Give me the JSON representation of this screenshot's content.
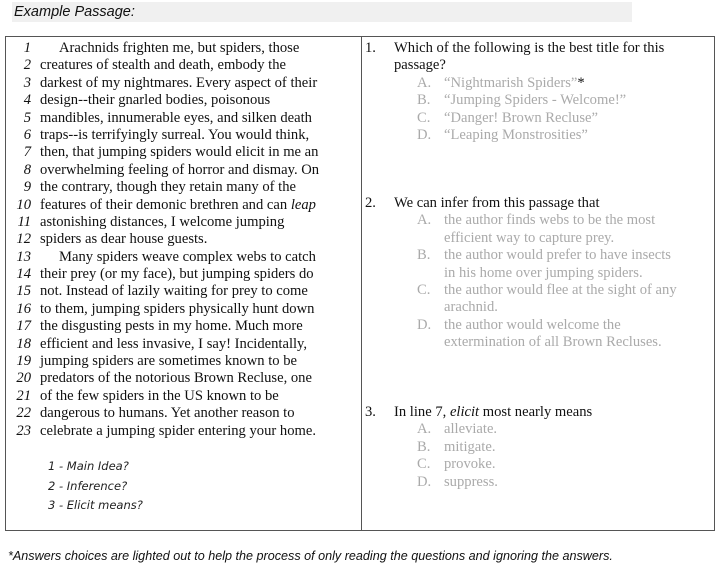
{
  "header": {
    "title": "Example Passage:"
  },
  "passage": {
    "lines": [
      {
        "n": "1",
        "text": "Arachnids frighten me, but spiders, those",
        "indent": true
      },
      {
        "n": "2",
        "text": "creatures of stealth and death, embody the"
      },
      {
        "n": "3",
        "text": "darkest of my nightmares.  Every aspect of their"
      },
      {
        "n": "4",
        "text": "design--their gnarled bodies, poisonous"
      },
      {
        "n": "5",
        "text": "mandibles, innumerable eyes, and silken death"
      },
      {
        "n": "6",
        "text": "traps--is terrifyingly surreal.  You would think,"
      },
      {
        "n": "7",
        "text": "then, that jumping spiders would elicit in me an"
      },
      {
        "n": "8",
        "text": "overwhelming feeling of horror and dismay.  On"
      },
      {
        "n": "9",
        "text": "the contrary, though they retain many of the"
      },
      {
        "n": "10",
        "text": "features of their demonic brethren and can ",
        "em": "leap"
      },
      {
        "n": "11",
        "text": "astonishing distances, I welcome jumping"
      },
      {
        "n": "12",
        "text": "spiders as dear house guests."
      },
      {
        "n": "13",
        "text": "Many spiders weave complex webs to catch",
        "indent": true
      },
      {
        "n": "14",
        "text": "their prey (or my face), but jumping spiders do"
      },
      {
        "n": "15",
        "text": "not.  Instead of lazily waiting for prey to come"
      },
      {
        "n": "16",
        "text": "to them, jumping spiders physically hunt down"
      },
      {
        "n": "17",
        "text": "the disgusting pests in my home.  Much more"
      },
      {
        "n": "18",
        "text": "efficient and less invasive, I say!  Incidentally,"
      },
      {
        "n": "19",
        "text": "jumping spiders are sometimes known to be"
      },
      {
        "n": "20",
        "text": "predators of the notorious Brown Recluse, one"
      },
      {
        "n": "21",
        "text": "of the few spiders in the US known to be"
      },
      {
        "n": "22",
        "text": "dangerous to humans.  Yet another reason to"
      },
      {
        "n": "23",
        "text": "celebrate a jumping spider entering your home."
      }
    ]
  },
  "notes": [
    "1 - Main Idea?",
    "2 - Inference?",
    "3 - Elicit means?"
  ],
  "questions": [
    {
      "n": "1.",
      "text": [
        "Which of the following is the best title for this",
        "passage?"
      ],
      "answers": [
        {
          "l": "A.",
          "t": [
            "“Nightmarish Spiders”"
          ],
          "mark": "*"
        },
        {
          "l": "B.",
          "t": [
            "“Jumping Spiders - Welcome!”"
          ]
        },
        {
          "l": "C.",
          "t": [
            "“Danger!  Brown Recluse”"
          ]
        },
        {
          "l": "D.",
          "t": [
            "“Leaping Monstrosities”"
          ]
        }
      ]
    },
    {
      "n": "2.",
      "text": [
        "We can infer from this passage that"
      ],
      "answers": [
        {
          "l": "A.",
          "t": [
            "the author finds webs to be the most",
            "efficient way to capture prey."
          ]
        },
        {
          "l": "B.",
          "t": [
            "the author would prefer to have insects",
            "in his home over jumping spiders."
          ]
        },
        {
          "l": "C.",
          "t": [
            "the author would flee at the sight of any",
            "arachnid."
          ]
        },
        {
          "l": "D.",
          "t": [
            "the author would welcome the",
            "extermination of all Brown Recluses."
          ]
        }
      ]
    },
    {
      "n": "3.",
      "pre": "In line 7, ",
      "em": "elicit",
      "post": " most nearly means",
      "answers": [
        {
          "l": "A.",
          "t": [
            "alleviate."
          ]
        },
        {
          "l": "B.",
          "t": [
            "mitigate."
          ]
        },
        {
          "l": "C.",
          "t": [
            "provoke."
          ]
        },
        {
          "l": "D.",
          "t": [
            "suppress."
          ]
        }
      ]
    }
  ],
  "footnote": "*Answers choices are lighted out to help the process of only reading the questions and ignoring the answers.",
  "colors": {
    "faded_answer": "#aaaaaa",
    "header_bg": "#f0f0f0"
  }
}
